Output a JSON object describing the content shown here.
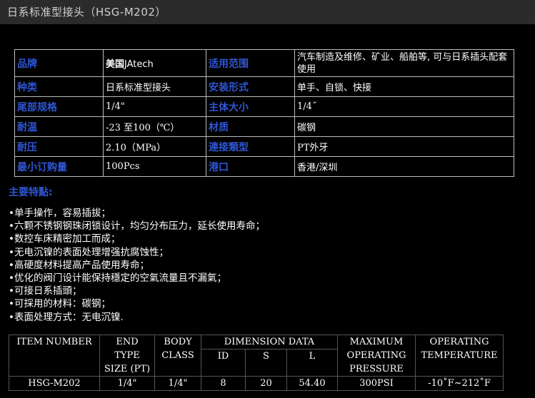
{
  "page": {
    "title": "日系标准型接头（HSG-M202）"
  },
  "spec": {
    "rows": [
      {
        "l1": "品牌",
        "v1a": "美国",
        "v1b": "JAtech",
        "l2": "适用范围",
        "v2": "汽车制造及维修、矿业、船舶等, 可与日系插头配套使用"
      },
      {
        "l1": "种类",
        "v1": "日系标准型接头",
        "l2": "安装形式",
        "v2": "单手、自锁、快接"
      },
      {
        "l1": "尾部规格",
        "v1": "1/4\"",
        "l2": "主体大小",
        "v2": "1/4˝"
      },
      {
        "l1": "耐温",
        "v1": "-23 至100（℃）",
        "l2": "材质",
        "v2": "碳钢"
      },
      {
        "l1": "耐压",
        "v1": "2.10（MPa）",
        "l2": "連接類型",
        "v2": "PT外牙"
      },
      {
        "l1": "最小订购量",
        "v1": "100Pcs",
        "l2": "港口",
        "v2": "香港/深圳"
      }
    ]
  },
  "features": {
    "title": "主要特點:",
    "items": [
      "•单手操作，容易插拔；",
      "•六颗不锈钢钢珠闭锁设计，均匀分布压力，延长使用寿命；",
      "•数控车床精密加工而成；",
      "•无电沉镍的表面处理增强抗腐蚀性；",
      "•高硬度材料提高产品使用寿命；",
      "•优化的阀门设计能保持穩定的空氣流量且不漏氣；",
      "•可接日系插頭；",
      "•可採用的材料：碳钢；",
      "•表面处理方式：无电沉镍."
    ]
  },
  "dims": {
    "h_item": "ITEM NUMBER",
    "h_end": [
      "END",
      "TYPE",
      "SIZE (PT)"
    ],
    "h_body": [
      "BODY",
      "CLASS"
    ],
    "h_dim": "DIMENSION DATA",
    "h_id": "ID",
    "h_s": "S",
    "h_l": "L",
    "h_max": [
      "MAXIMUM",
      "OPERATING",
      "PRESSURE"
    ],
    "h_temp": [
      "OPERATING",
      "TEMPERATURE"
    ],
    "row": {
      "item": "HSG-M202",
      "end": "1/4\"",
      "body": "1/4\"",
      "id": "8",
      "s": "20",
      "l": "54.40",
      "pressure": "300PSI",
      "temp": "-10˚F~212˚F"
    }
  }
}
